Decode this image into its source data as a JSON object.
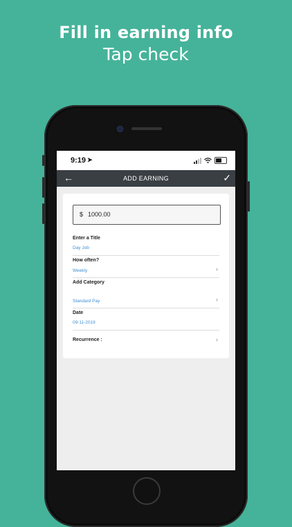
{
  "promo": {
    "headline": "Fill in earning info",
    "subline": "Tap check"
  },
  "status_bar": {
    "time": "9:19",
    "location_arrow": "➤"
  },
  "app_bar": {
    "title": "ADD EARNING",
    "back_icon": "←",
    "confirm_icon": "✓"
  },
  "form": {
    "amount": {
      "currency": "$",
      "value": "1000.00"
    },
    "title": {
      "label": "Enter a Title",
      "value": "Day Job"
    },
    "frequency": {
      "label": "How often?",
      "value": "Weekly"
    },
    "category": {
      "label": "Add Category",
      "value": "Standard Pay"
    },
    "date": {
      "label": "Date",
      "value": "09-11-2019"
    },
    "recurrence": {
      "label": "Recurrence :"
    }
  },
  "colors": {
    "background": "#45b39a",
    "app_bar": "#3a3f44",
    "field_value": "#3d8fd6"
  }
}
